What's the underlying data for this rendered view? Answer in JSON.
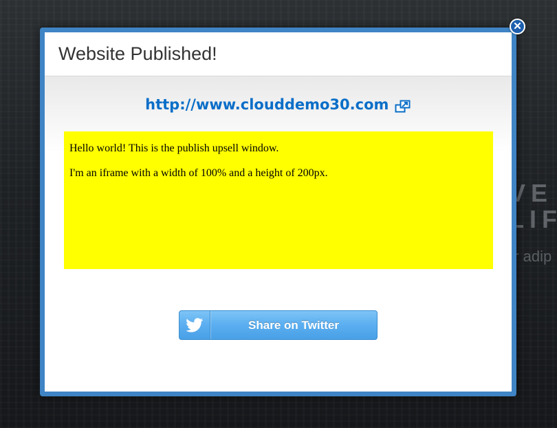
{
  "modal": {
    "title": "Website Published!",
    "site_url": "http://www.clouddemo30.com",
    "iframe": {
      "line1": "Hello world! This is the publish upsell window.",
      "line2": "I'm an iframe with a width of 100% and a height of 200px."
    },
    "share_button_label": "Share on Twitter"
  },
  "background": {
    "text_line1": "VE",
    "text_line2": "LIF",
    "text_line3": "ur adip"
  },
  "icons": {
    "close": "close-icon",
    "external_link": "external-link-icon",
    "twitter": "twitter-bird-icon"
  },
  "colors": {
    "modal_border": "#3f84c4",
    "link": "#0a6ec8",
    "iframe_bg": "#ffff00",
    "twitter_button": "#5aaef0",
    "close_button": "#1d5fae"
  }
}
